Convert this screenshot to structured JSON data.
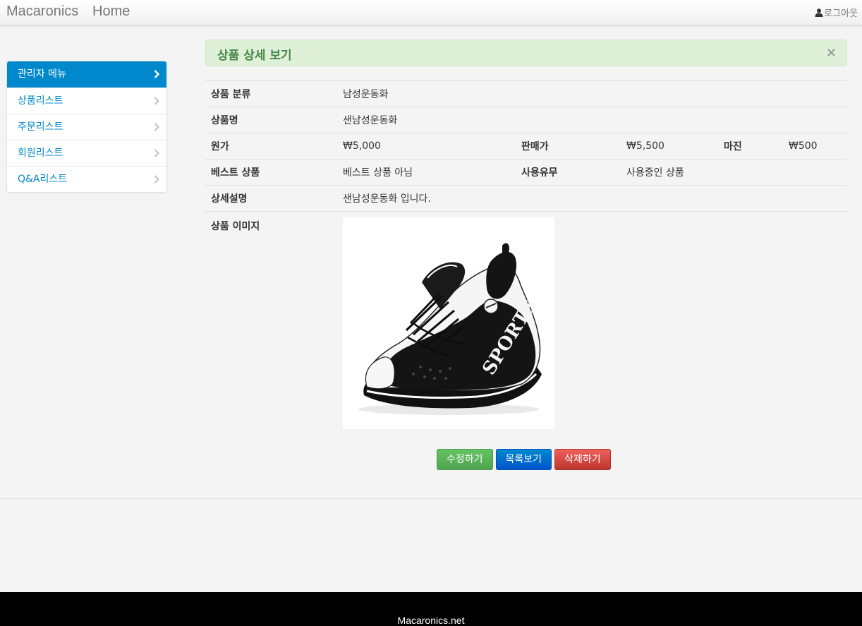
{
  "navbar": {
    "brand": "Macaronics",
    "home": "Home",
    "logout": "로그아웃"
  },
  "sidebar": {
    "header": "관리자 메뉴",
    "items": [
      {
        "label": "상품리스트"
      },
      {
        "label": "주문리스트"
      },
      {
        "label": "회원리스트"
      },
      {
        "label": "Q&A리스트"
      }
    ]
  },
  "alert": {
    "title": "상품 상세 보기",
    "close": "×"
  },
  "detail": {
    "category_label": "상품 분류",
    "category_value": "남성운동화",
    "name_label": "상품명",
    "name_value": "샌남성운동화",
    "cost_label": "원가",
    "cost_value": "₩5,000",
    "price_label": "판매가",
    "price_value": "₩5,500",
    "margin_label": "마진",
    "margin_value": "₩500",
    "best_label": "베스트 상품",
    "best_value": "베스트 상품 아님",
    "use_label": "사용유무",
    "use_value": "사용중인 상품",
    "desc_label": "상세설명",
    "desc_value": "샌남성운동화 입니다.",
    "image_label": "상품 이미지",
    "image_lettering": "SPORTS"
  },
  "buttons": {
    "edit": "수정하기",
    "list": "목록보기",
    "delete": "삭제하기"
  },
  "footer": {
    "text": "Macaronics.net"
  },
  "colors": {
    "accent": "#0088cc",
    "alert_bg": "#dff0d8",
    "alert_text": "#468847",
    "edit_button": "#5bb75b",
    "list_button": "#0074cc",
    "delete_button": "#da4f49"
  }
}
